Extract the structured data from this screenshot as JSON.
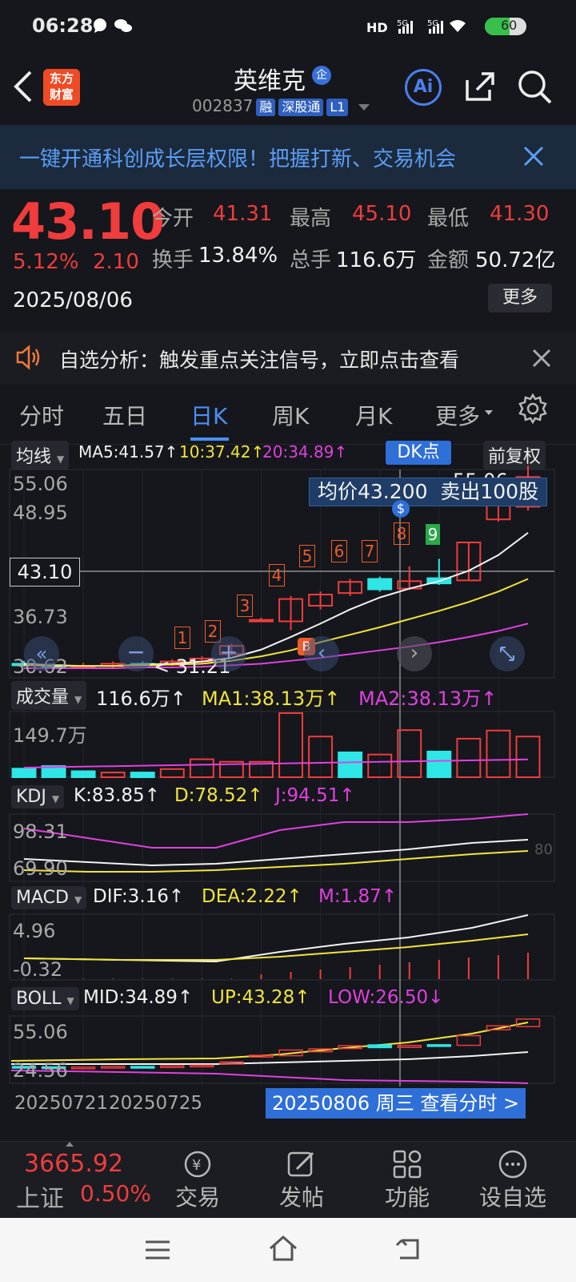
{
  "status": {
    "time": "06:28",
    "battery": "60"
  },
  "header": {
    "logo_line1": "东方",
    "logo_line2": "财富",
    "stock_name": "英维克",
    "stock_code": "002837",
    "tags": [
      "融",
      "深股通",
      "L1"
    ],
    "ai_label": "Ai"
  },
  "banner": {
    "text": "一键开通科创成长层权限！把握打新、交易机会"
  },
  "quote": {
    "price": "43.10",
    "change_pct": "5.12%",
    "change": "2.10",
    "date": "2025/08/06",
    "open_label": "今开",
    "open": "41.31",
    "high_label": "最高",
    "high": "45.10",
    "low_label": "最低",
    "low": "41.30",
    "turnover_label": "换手",
    "turnover": "13.84%",
    "volume_label": "总手",
    "volume": "116.6万",
    "amount_label": "金额",
    "amount": "50.72亿",
    "more": "更多"
  },
  "signal": {
    "text": "自选分析：触发重点关注信号，立即点击查看"
  },
  "tabs": [
    "分时",
    "五日",
    "日K",
    "周K",
    "月K",
    "更多"
  ],
  "active_tab": "日K",
  "kline": {
    "ma_label": "均线",
    "ma5": "MA5:41.57",
    "ma10": "10:37.42",
    "ma20": "20:34.89",
    "dk_button": "DK点",
    "adjust_button": "前复权",
    "price_ticks": [
      "55.06",
      "48.95",
      "43.10",
      "36.73",
      "30.62"
    ],
    "crosshair_value": "43.10",
    "tooltip": "均价43.200  卖出100股",
    "top_value": "55.06",
    "low_marker": "< 31.21",
    "signals": [
      "1",
      "2",
      "3",
      "4",
      "5",
      "6",
      "7",
      "8",
      "9"
    ],
    "b_marker": "B",
    "s_marker": "$"
  },
  "chart_data": {
    "type": "candlestick",
    "candles": [
      {
        "o": 30.9,
        "c": 30.7,
        "h": 31.3,
        "l": 30.5
      },
      {
        "o": 30.7,
        "c": 30.4,
        "h": 31.0,
        "l": 30.2
      },
      {
        "o": 30.4,
        "c": 30.6,
        "h": 31.0,
        "l": 30.2
      },
      {
        "o": 30.6,
        "c": 30.9,
        "h": 31.2,
        "l": 30.4
      },
      {
        "o": 30.9,
        "c": 30.8,
        "h": 31.2,
        "l": 30.6
      },
      {
        "o": 30.8,
        "c": 31.2,
        "h": 31.5,
        "l": 30.6
      },
      {
        "o": 31.2,
        "c": 31.6,
        "h": 31.9,
        "l": 31.0
      },
      {
        "o": 32.2,
        "c": 33.3,
        "h": 33.6,
        "l": 32.0
      },
      {
        "o": 36.8,
        "c": 36.8,
        "h": 37.1,
        "l": 36.5
      },
      {
        "o": 36.6,
        "c": 39.6,
        "h": 40.0,
        "l": 35.4
      },
      {
        "o": 38.7,
        "c": 40.2,
        "h": 40.6,
        "l": 38.2
      },
      {
        "o": 40.4,
        "c": 41.9,
        "h": 42.3,
        "l": 40.0
      },
      {
        "o": 42.3,
        "c": 40.9,
        "h": 42.6,
        "l": 40.6
      },
      {
        "o": 41.0,
        "c": 42.0,
        "h": 44.0,
        "l": 40.8
      },
      {
        "o": 42.4,
        "c": 41.7,
        "h": 45.0,
        "l": 41.5
      },
      {
        "o": 42.1,
        "c": 47.2,
        "h": 47.2,
        "l": 42.0
      },
      {
        "o": 50.3,
        "c": 52.4,
        "h": 53.5,
        "l": 50.0
      },
      {
        "o": 52.0,
        "c": 56.0,
        "h": 57.5,
        "l": 51.5
      }
    ],
    "ma5": [
      30.9,
      30.7,
      30.6,
      30.6,
      30.8,
      30.9,
      31.2,
      31.7,
      32.8,
      34.5,
      36.3,
      38.2,
      39.8,
      41.0,
      42.0,
      43.4,
      45.5,
      48.5
    ],
    "ma10": [
      30.7,
      30.6,
      30.6,
      30.6,
      30.7,
      30.8,
      30.9,
      31.3,
      31.9,
      32.7,
      33.8,
      34.8,
      35.8,
      36.9,
      38.0,
      39.2,
      40.6,
      42.3
    ],
    "ma20": [
      30.3,
      30.3,
      30.3,
      30.3,
      30.4,
      30.4,
      30.5,
      30.7,
      30.9,
      31.3,
      31.7,
      32.2,
      32.7,
      33.2,
      33.8,
      34.5,
      35.3,
      36.3
    ],
    "volume": {
      "label": "成交量",
      "value": "116.6万",
      "ma1": "MA1:38.13万",
      "ma2": "MA2:38.13万",
      "tick": "149.7万",
      "values": [
        20,
        26,
        14,
        11,
        11,
        19,
        42,
        36,
        36,
        149.7,
        95,
        58,
        53,
        110,
        60,
        90,
        109,
        95
      ],
      "up": [
        false,
        false,
        false,
        true,
        false,
        true,
        true,
        true,
        true,
        true,
        true,
        false,
        true,
        true,
        false,
        true,
        true,
        true
      ]
    },
    "kdj": {
      "label": "KDJ",
      "k": "K:83.85",
      "d": "D:78.52",
      "j": "J:94.51",
      "ticks": [
        "98.31",
        "69.90"
      ],
      "right_tick": "80"
    },
    "macd": {
      "label": "MACD",
      "dif": "DIF:3.16",
      "dea": "DEA:2.22",
      "m": "M:1.87",
      "ticks": [
        "4.96",
        "-0.32"
      ]
    },
    "boll": {
      "label": "BOLL",
      "mid": "MID:34.89",
      "up": "UP:43.28",
      "low": "LOW:26.50",
      "ticks": [
        "55.06",
        "24.56"
      ]
    },
    "xaxis": {
      "left": "20250721",
      "mid": "20250725",
      "selected": "20250806 周三 查看分时 >"
    }
  },
  "bottom_nav": {
    "index_value": "3665.92",
    "index_name": "上证",
    "index_change": "0.50%",
    "items": [
      "交易",
      "发帖",
      "功能",
      "设自选"
    ]
  }
}
